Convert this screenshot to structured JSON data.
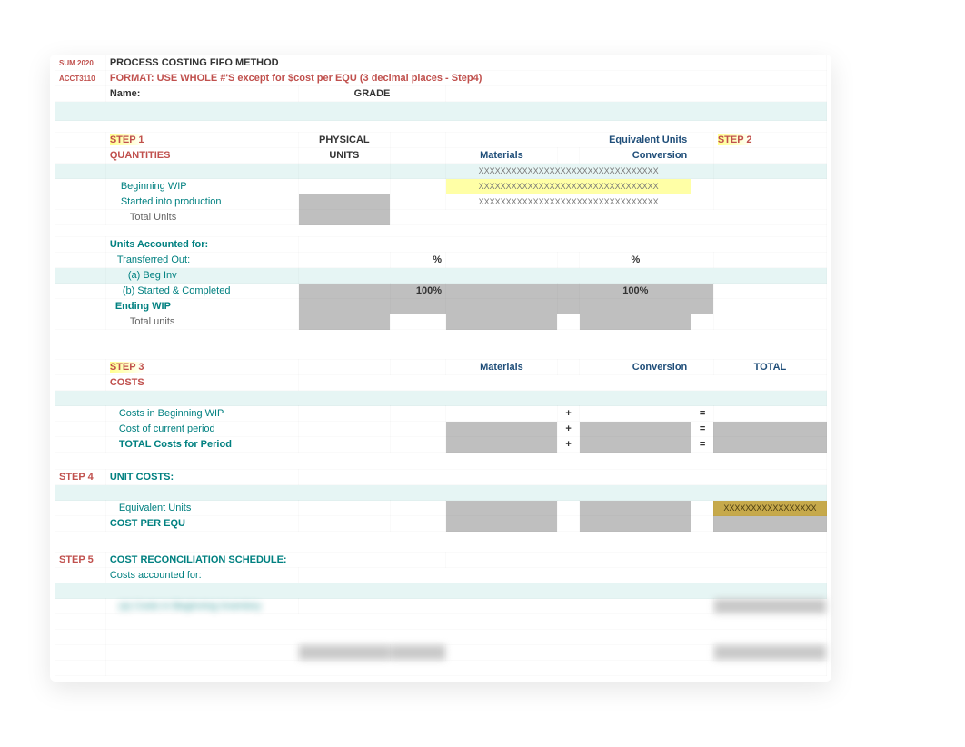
{
  "meta": {
    "term": "SUM 2020",
    "course": "ACCT3110"
  },
  "hdr": {
    "title": "PROCESS COSTING FIFO METHOD",
    "format": "FORMAT:  USE WHOLE #'S except for $cost per EQU  (3 decimal places - Step4)",
    "name": "Name:",
    "grade": "GRADE"
  },
  "s1": {
    "step": "STEP 1",
    "quantities": "QUANTITIES",
    "physical": "PHYSICAL",
    "units": "UNITS",
    "equivUnits": "Equivalent Units",
    "step2": "STEP 2",
    "materials": "Materials",
    "conversion": "Conversion",
    "begWip": "Beginning WIP",
    "started": "Started into production",
    "totalUnits": "Total Units",
    "xrow": "XXXXXXXXXXXXXXXXXXXXXXXXXXXXXXXXX",
    "unitsAcct": "Units Accounted for:",
    "transOut": "Transferred Out:",
    "pct": "%",
    "aBeg": "(a) Beg Inv",
    "bSC": "(b) Started & Completed",
    "p100": "100%",
    "endWip": "Ending WIP",
    "totalunits": "Total units"
  },
  "s3": {
    "step": "STEP 3",
    "costs": "COSTS",
    "materials": "Materials",
    "conversion": "Conversion",
    "total": "TOTAL",
    "cib": "Costs in  Beginning WIP",
    "ccp": "Cost of current period",
    "tot": "TOTAL Costs for Period",
    "plus": "+",
    "eq": "="
  },
  "s4": {
    "step": "STEP 4",
    "unitCosts": "UNIT COSTS:",
    "equ": "Equivalent Units",
    "cpe": "COST PER EQU",
    "x": "XXXXXXXXXXXXXXXXX"
  },
  "s5": {
    "step": "STEP 5",
    "title": "COST RECONCILIATION SCHEDULE:",
    "caf": "Costs accounted for:",
    "a": "(a) Costs in Beginning Inventory"
  }
}
